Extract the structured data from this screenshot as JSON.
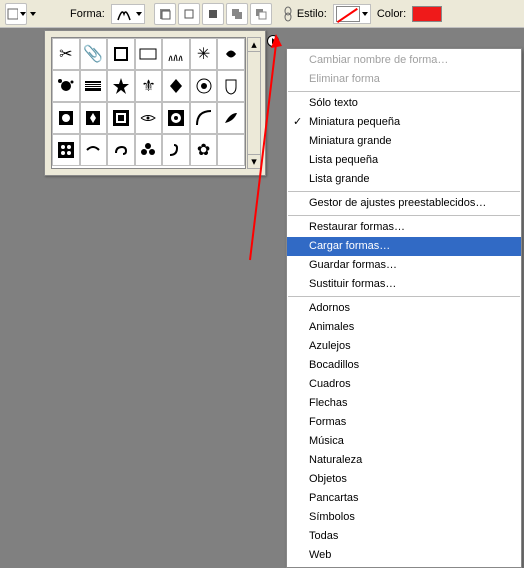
{
  "toolbar": {
    "shape_label": "Forma:",
    "style_label": "Estilo:",
    "color_label": "Color:",
    "color_value": "#ef1a1a"
  },
  "shapes_grid": {
    "rows": 4,
    "cols": 7,
    "icons": [
      "scissors",
      "paperclip",
      "stamp",
      "envelope",
      "grass",
      "snowflake",
      "tree-ornament",
      "splat",
      "flag-us",
      "star",
      "fleur-de-lis",
      "diamond",
      "badge",
      "crest",
      "ornament",
      "ornament2",
      "pattern-tile",
      "flourish",
      "rosette",
      "corner",
      "leaf-swirl",
      "flower-block",
      "vine",
      "swirl",
      "floral",
      "curl",
      "flower",
      "blank"
    ]
  },
  "menu": {
    "rename": "Cambiar nombre de forma…",
    "delete": "Eliminar forma",
    "text_only": "Sólo texto",
    "thumb_small": "Miniatura pequeña",
    "thumb_large": "Miniatura grande",
    "list_small": "Lista pequeña",
    "list_large": "Lista grande",
    "preset_mgr": "Gestor de ajustes preestablecidos…",
    "restore": "Restaurar formas…",
    "load": "Cargar formas…",
    "save": "Guardar formas…",
    "replace": "Sustituir formas…",
    "cat_adornos": "Adornos",
    "cat_animales": "Animales",
    "cat_azulejos": "Azulejos",
    "cat_bocadillos": "Bocadillos",
    "cat_cuadros": "Cuadros",
    "cat_flechas": "Flechas",
    "cat_formas": "Formas",
    "cat_musica": "Música",
    "cat_naturaleza": "Naturaleza",
    "cat_objetos": "Objetos",
    "cat_pancartas": "Pancartas",
    "cat_simbolos": "Símbolos",
    "cat_todas": "Todas",
    "cat_web": "Web"
  }
}
